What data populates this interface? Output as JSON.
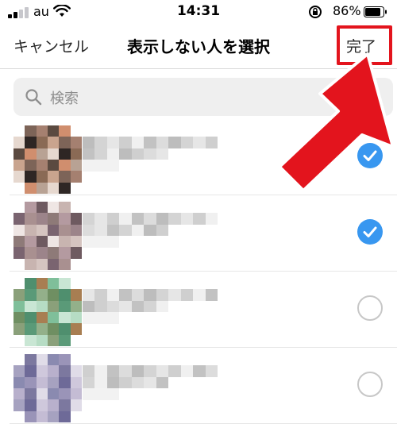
{
  "status": {
    "carrier": "au",
    "time": "14:31",
    "battery": "86%",
    "battery_level": 0.86
  },
  "nav": {
    "cancel": "キャンセル",
    "title": "表示しない人を選択",
    "done": "完了"
  },
  "search": {
    "placeholder": "検索"
  },
  "list": {
    "rows": [
      {
        "selected": true
      },
      {
        "selected": true
      },
      {
        "selected": false
      },
      {
        "selected": false
      }
    ]
  },
  "colors": {
    "check_blue": "#3897f0",
    "highlight_red": "#e3141d"
  }
}
